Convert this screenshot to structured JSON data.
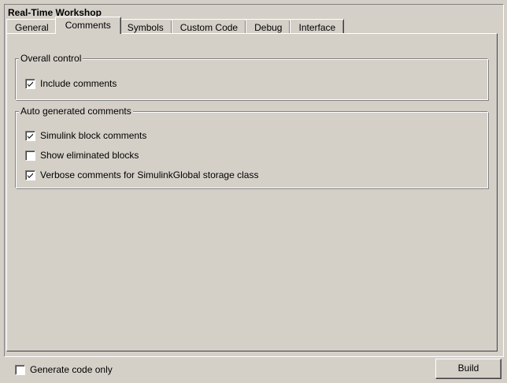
{
  "panel": {
    "title": "Real-Time Workshop"
  },
  "tabs": [
    {
      "label": "General",
      "active": false
    },
    {
      "label": "Comments",
      "active": true
    },
    {
      "label": "Symbols",
      "active": false
    },
    {
      "label": "Custom Code",
      "active": false
    },
    {
      "label": "Debug",
      "active": false
    },
    {
      "label": "Interface",
      "active": false
    }
  ],
  "overall_control": {
    "legend": "Overall control",
    "include_comments": {
      "label": "Include comments",
      "checked": true
    }
  },
  "auto_generated": {
    "legend": "Auto generated comments",
    "items": [
      {
        "label": "Simulink block comments",
        "checked": true
      },
      {
        "label": "Show eliminated blocks",
        "checked": false
      },
      {
        "label": "Verbose comments for SimulinkGlobal storage class",
        "checked": true
      }
    ]
  },
  "footer": {
    "generate_code_only": {
      "label": "Generate code only",
      "checked": false
    },
    "build_label": "Build"
  },
  "icons": {
    "checkmark": "checkmark-icon"
  }
}
